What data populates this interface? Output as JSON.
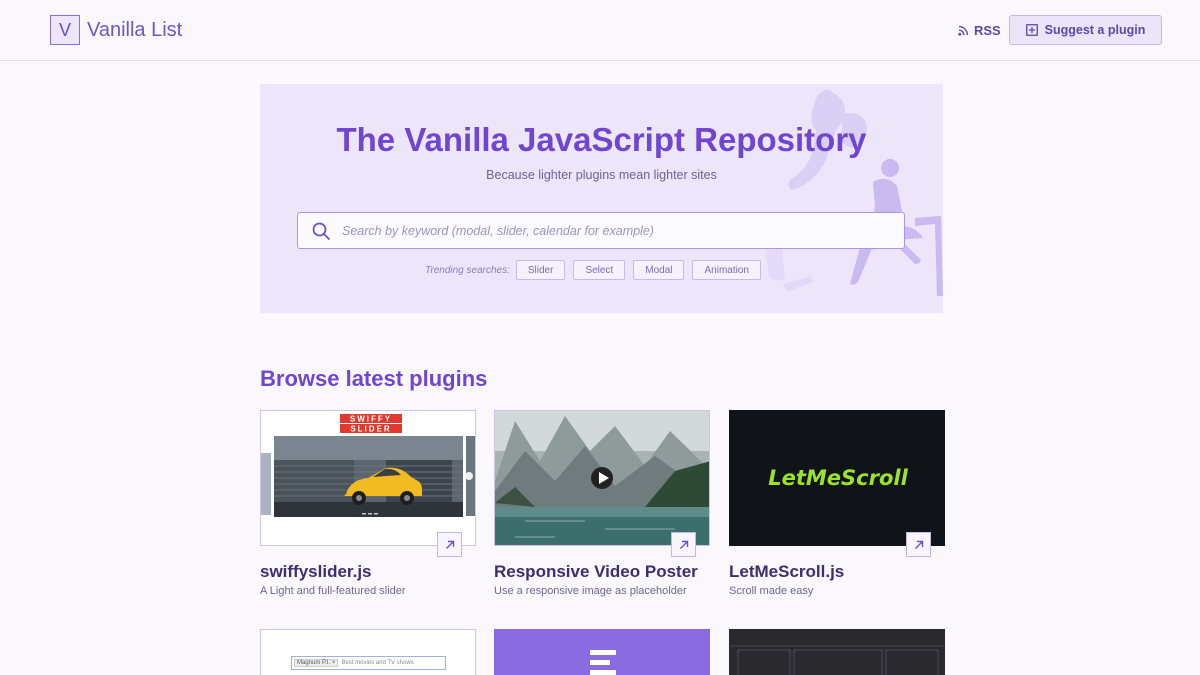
{
  "header": {
    "logo_letter": "V",
    "logo_text": "Vanilla List",
    "rss_label": "RSS",
    "suggest_label": "Suggest a plugin"
  },
  "hero": {
    "title": "The Vanilla JavaScript Repository",
    "subtitle": "Because lighter plugins mean lighter sites",
    "search_placeholder": "Search by keyword (modal, slider, calendar for example)",
    "search_value": "",
    "trending_label": "Trending searches:",
    "trending": [
      "Slider",
      "Select",
      "Modal",
      "Animation"
    ]
  },
  "section": {
    "title": "Browse latest plugins"
  },
  "plugins": [
    {
      "name": "swiffyslider.js",
      "description": "A Light and full-featured slider",
      "thumb_text_1": "SWIFFY",
      "thumb_text_2": "SLIDER"
    },
    {
      "name": "Responsive Video Poster",
      "description": "Use a responsive image as placeholder"
    },
    {
      "name": "LetMeScroll.js",
      "description": "Scroll made easy",
      "thumb_text": "LetMeScroll"
    }
  ],
  "row2": {
    "tag": "Magnum P.I.",
    "tag_close": "×",
    "input_text": "Best movies and TV shows"
  },
  "colors": {
    "accent": "#7045d2",
    "hero_bg": "#ede6fa",
    "letmescroll_green": "#9be22d"
  }
}
